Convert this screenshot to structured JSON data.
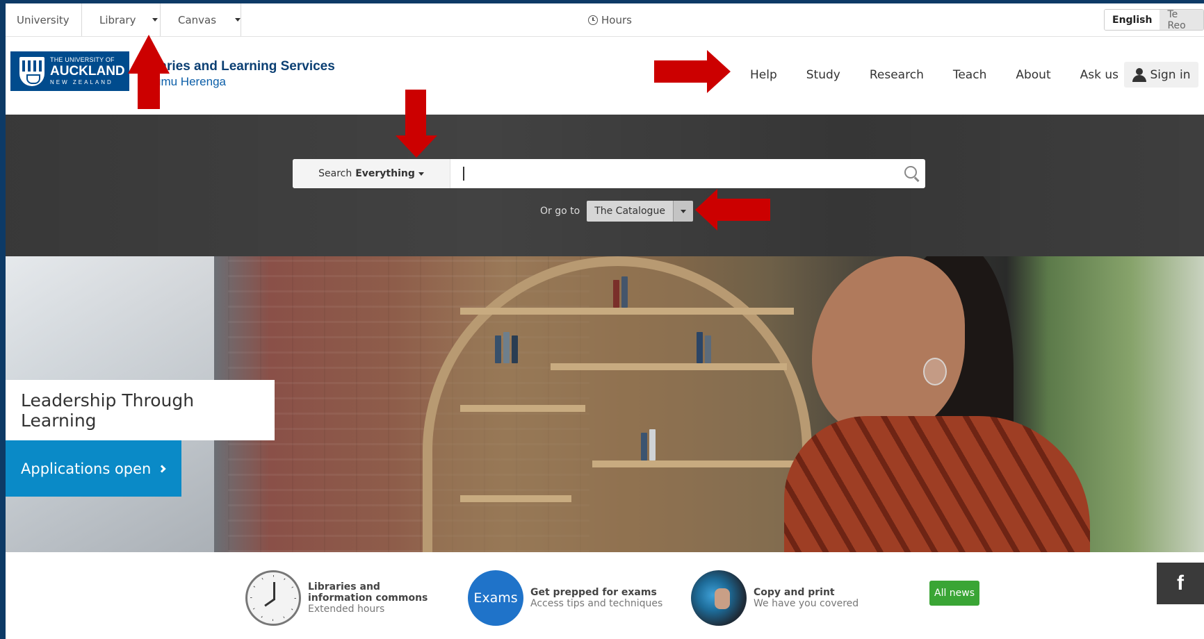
{
  "util_bar": {
    "university": "University",
    "library": "Library",
    "canvas": "Canvas",
    "hours": "Hours",
    "lang_english": "English",
    "lang_tereo": "Te Reo"
  },
  "header": {
    "logo": {
      "line1": "THE UNIVERSITY OF",
      "line2": "AUCKLAND",
      "line3": "NEW ZEALAND"
    },
    "site_title": "raries and Learning Services",
    "site_subtitle": "umu Herenga",
    "nav": [
      "Help",
      "Study",
      "Research",
      "Teach",
      "About",
      "Ask us"
    ],
    "sign_in": "Sign in"
  },
  "search": {
    "scope_prefix": "Search",
    "scope_value": "Everything",
    "input_value": "",
    "goto_label": "Or go to",
    "goto_selected": "The Catalogue"
  },
  "hero": {
    "caption": "Leadership Through Learning",
    "cta": "Applications open"
  },
  "news": {
    "items": [
      {
        "title": "Libraries and information commons",
        "sub": "Extended hours",
        "icon": "clock-icon"
      },
      {
        "title": "Get prepped for exams",
        "sub": "Access tips and techniques",
        "icon_text": "Exams"
      },
      {
        "title": "Copy and print",
        "sub": "We have you covered",
        "icon": "print-card-icon"
      }
    ],
    "all_news": "All news",
    "facebook": "f"
  },
  "colors": {
    "brand_blue": "#004b8d",
    "search_band": "#323232",
    "cta_blue": "#0a8ac7",
    "all_news_green": "#3aa535",
    "annotation_red": "#cc0000"
  }
}
